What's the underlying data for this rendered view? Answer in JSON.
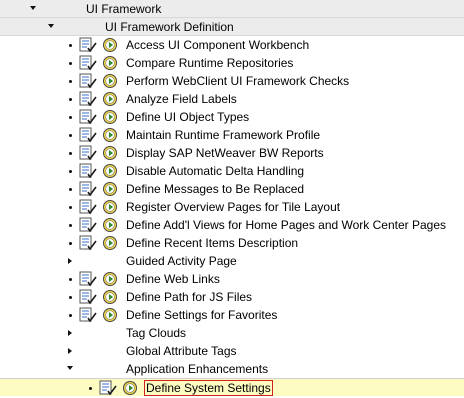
{
  "tree": {
    "level1": {
      "label": "UI Framework",
      "expanded": true
    },
    "level2": {
      "label": "UI Framework Definition",
      "expanded": true
    },
    "items": [
      {
        "label": "Access UI Component Workbench",
        "kind": "activity"
      },
      {
        "label": "Compare Runtime Repositories",
        "kind": "activity"
      },
      {
        "label": "Perform WebClient UI Framework Checks",
        "kind": "activity"
      },
      {
        "label": "Analyze Field Labels",
        "kind": "activity"
      },
      {
        "label": "Define UI Object Types",
        "kind": "activity"
      },
      {
        "label": "Maintain Runtime Framework Profile",
        "kind": "activity"
      },
      {
        "label": "Display SAP NetWeaver BW Reports",
        "kind": "activity"
      },
      {
        "label": "Disable Automatic Delta Handling",
        "kind": "activity"
      },
      {
        "label": "Define Messages to Be Replaced",
        "kind": "activity"
      },
      {
        "label": "Register Overview Pages for Tile Layout",
        "kind": "activity"
      },
      {
        "label": "Define Add'l Views for Home Pages and Work Center Pages",
        "kind": "activity"
      },
      {
        "label": "Define Recent Items Description",
        "kind": "activity"
      },
      {
        "label": "Guided Activity Page",
        "kind": "folder"
      },
      {
        "label": "Define Web Links",
        "kind": "activity"
      },
      {
        "label": "Define Path for JS Files",
        "kind": "activity"
      },
      {
        "label": "Define Settings for Favorites",
        "kind": "activity"
      },
      {
        "label": "Tag Clouds",
        "kind": "folder"
      },
      {
        "label": "Global Attribute Tags",
        "kind": "folder"
      },
      {
        "label": "Application Enhancements",
        "kind": "folder-open"
      }
    ],
    "selected_item": {
      "label": "Define System Settings",
      "kind": "activity",
      "selected": true
    }
  },
  "colors": {
    "band": "#ececec",
    "selected_row": "#fbfbc2",
    "selected_border": "#d02020",
    "clock_face": "#f2d84a",
    "doc_blue": "#3b6fc9"
  },
  "icons": {
    "expanded": "triangle-down-icon",
    "collapsed": "triangle-right-icon",
    "document": "document-with-checkmark-icon",
    "execute": "clock-execute-icon"
  }
}
